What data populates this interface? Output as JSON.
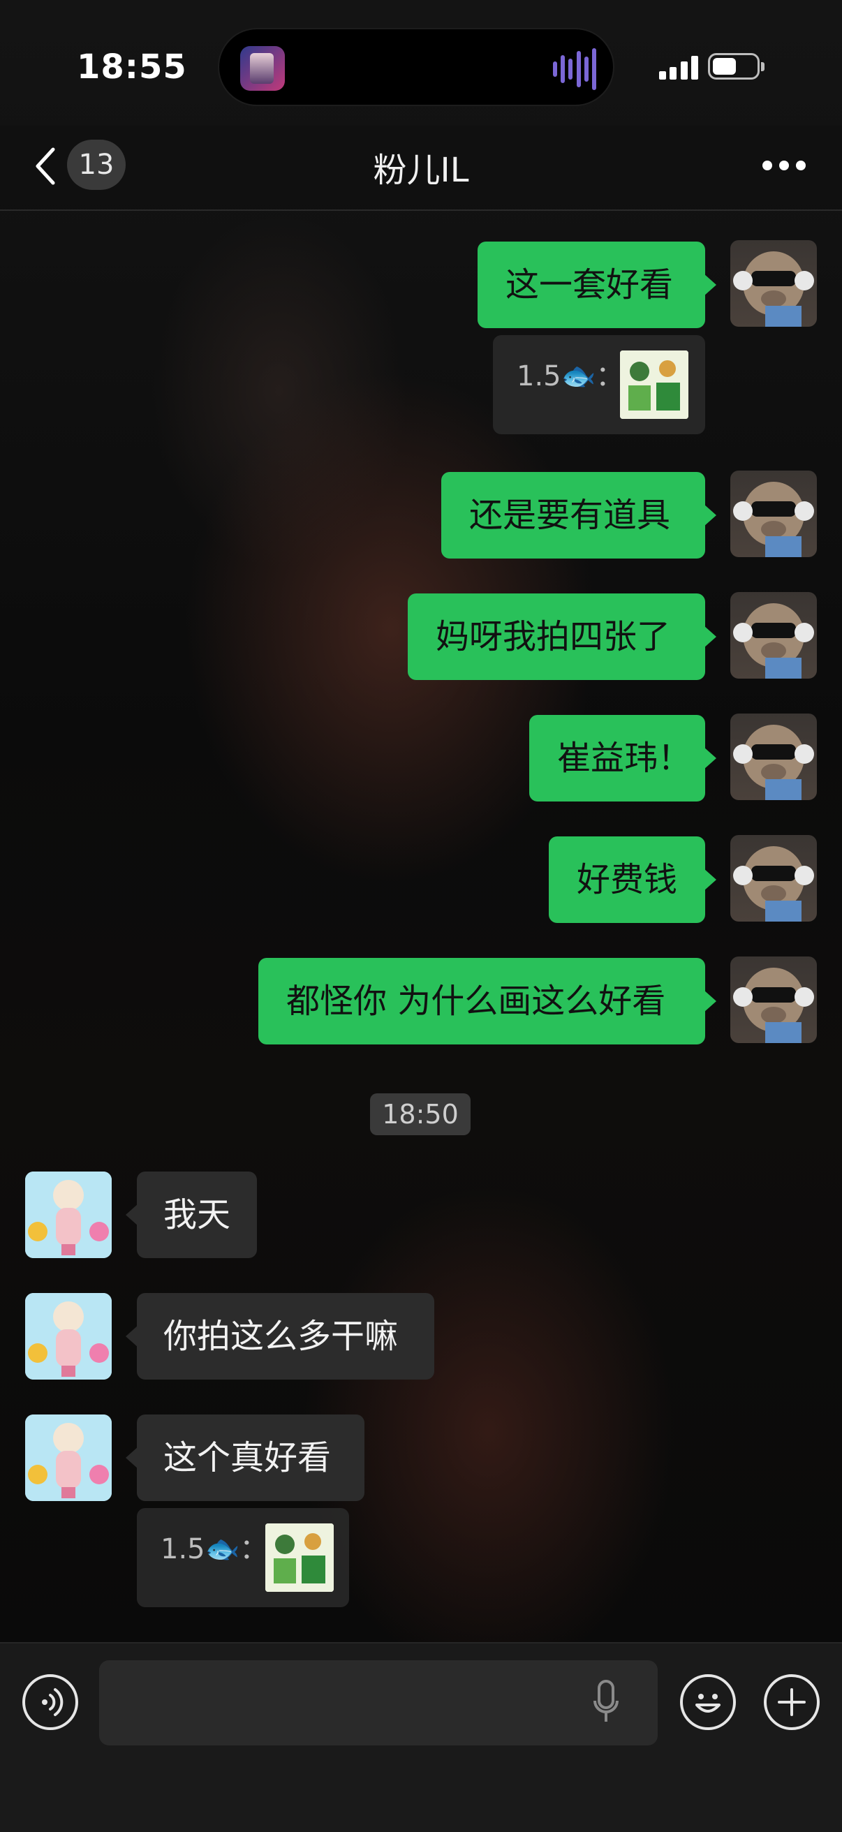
{
  "status_bar": {
    "time": "18:55",
    "battery_level": 0.55,
    "signal_bars": 4
  },
  "nav": {
    "unread_count": "13",
    "title": "粉儿IL"
  },
  "messages": [
    {
      "side": "out",
      "text": "这一套好看"
    },
    {
      "side": "out-quote",
      "quote": "1.5🐟："
    },
    {
      "side": "out",
      "text": "还是要有道具"
    },
    {
      "side": "out",
      "text": "妈呀我拍四张了"
    },
    {
      "side": "out",
      "text": "崔益玮！"
    },
    {
      "side": "out",
      "text": "好费钱"
    },
    {
      "side": "out",
      "text": "都怪你 为什么画这么好看"
    },
    {
      "side": "time",
      "text": "18:50"
    },
    {
      "side": "in",
      "text": "我天"
    },
    {
      "side": "in",
      "text": "你拍这么多干嘛"
    },
    {
      "side": "in",
      "text": "这个真好看"
    },
    {
      "side": "in-quote",
      "quote": "1.5🐟："
    }
  ],
  "input": {
    "placeholder": ""
  },
  "icons": {
    "voice": "voice-mode-icon",
    "mic": "microphone-icon",
    "emoji": "emoji-icon",
    "plus": "plus-icon"
  },
  "colors": {
    "outgoing_bubble": "#29c15a",
    "incoming_bubble": "#2c2c2c"
  }
}
